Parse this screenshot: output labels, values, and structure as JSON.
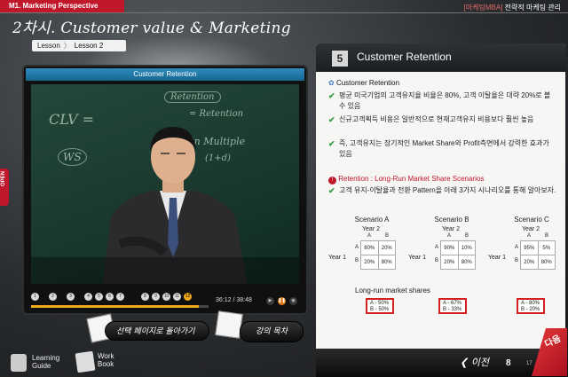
{
  "header": {
    "module": "M1. Marketing Perspective",
    "brand_prefix": "[마케팅MBA]",
    "brand_suffix": "전략적 마케팅 관리",
    "course_title": "2차시. Customer value & Marketing",
    "breadcrumb_lesson": "Lesson",
    "breadcrumb_sep": "〉",
    "breadcrumb_current": "Lesson 2"
  },
  "player": {
    "title": "Customer Retention",
    "chapters": [
      "1",
      "2",
      "3",
      "4",
      "5",
      "6",
      "7",
      "8",
      "9",
      "10",
      "11",
      "12"
    ],
    "active_chapter": 12,
    "progress": 0.947,
    "time": "36:12 / 38:48",
    "board_words": [
      "Retention",
      "= Retention",
      "CLV =",
      "Margin Multiple",
      "(1+d)",
      "WS"
    ]
  },
  "side_tab": {
    "label": "OPEN"
  },
  "buttons": {
    "first_page": "선택 페이지로 돌아가기",
    "lecture_notes": "강의 목차"
  },
  "bottom_nav": {
    "learning_guide": [
      "Learning",
      "Guide"
    ],
    "work_book": [
      "Work",
      "Book"
    ]
  },
  "slide": {
    "number": "5",
    "title": "Customer Retention",
    "section1": "Customer Retention",
    "bullets": [
      "평균 미국기업의 고객유지율 비율은 80%, 고객 이탈율은 대략 20%로 볼 수 있음",
      "신규고객획득 비용은 일반적으로 현재고객유지 비용보다 훨씬 높음",
      "즉, 고객유지는 장기적인 Market Share와 Profit측면에서 강력한 효과가 있음"
    ],
    "section2": "Retention : Long-Run Market Share Scenarios",
    "bullet4": "고객 유지-이탈율과 전환 Pattern을 아래 3가지 시나리오를 통해 알아보자.",
    "year1": "Year 1",
    "year2": "Year 2",
    "col_a": "A",
    "col_b": "B",
    "scenarios": [
      {
        "name": "Scenario A",
        "cells": [
          [
            "80%",
            "20%"
          ],
          [
            "20%",
            "80%"
          ]
        ],
        "long_run": [
          "A - 50%",
          "B - 50%"
        ]
      },
      {
        "name": "Scenario B",
        "cells": [
          [
            "90%",
            "10%"
          ],
          [
            "20%",
            "80%"
          ]
        ],
        "long_run": [
          "A - 67%",
          "B - 33%"
        ]
      },
      {
        "name": "Scenario C",
        "cells": [
          [
            "95%",
            "5%"
          ],
          [
            "20%",
            "80%"
          ]
        ],
        "long_run": [
          "A - 80%",
          "B - 20%"
        ]
      }
    ],
    "long_run_title": "Long-run market shares"
  },
  "pager": {
    "prev": "이전",
    "current": "8",
    "total": "17",
    "next": "다음"
  }
}
